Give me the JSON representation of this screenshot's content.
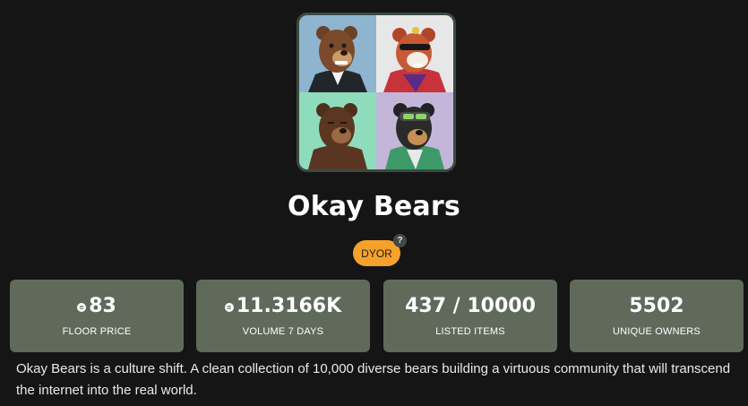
{
  "collection": {
    "title": "Okay Bears",
    "badge": "DYOR",
    "help_icon": "?",
    "description": "Okay Bears is a culture shift. A clean collection of 10,000 diverse bears building a virtuous community that will transcend the internet into the real world."
  },
  "stats": [
    {
      "value": "83",
      "label": "FLOOR PRICE",
      "currency_icon": "sol-icon"
    },
    {
      "value": "11.3166K",
      "label": "VOLUME 7 DAYS",
      "currency_icon": "sol-icon"
    },
    {
      "value": "437 / 10000",
      "label": "LISTED ITEMS"
    },
    {
      "value": "5502",
      "label": "UNIQUE OWNERS"
    }
  ],
  "collage_tiles": [
    {
      "name": "bear-blue-tile",
      "bg": "#8fb4cf"
    },
    {
      "name": "bear-white-tile",
      "bg": "#e7e7e7"
    },
    {
      "name": "bear-mint-tile",
      "bg": "#8fdcbd"
    },
    {
      "name": "bear-lavender-tile",
      "bg": "#c3b6d8"
    }
  ],
  "colors": {
    "background": "#151515",
    "stat_card": "#5f6a5b",
    "badge": "#f6a12b"
  }
}
